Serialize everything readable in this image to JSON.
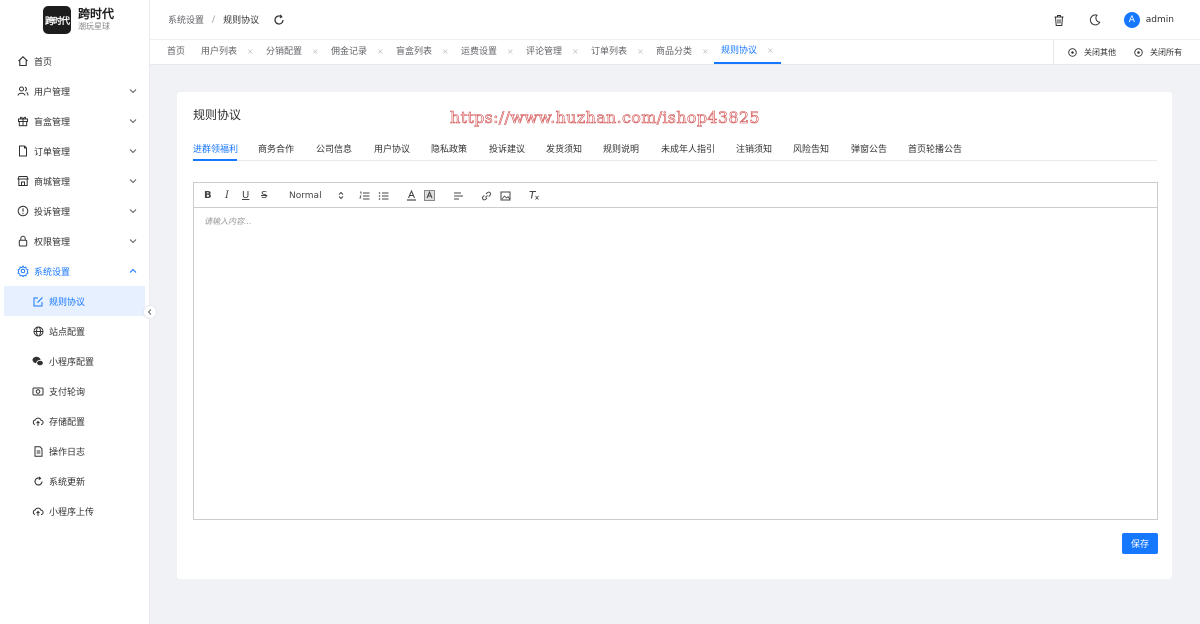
{
  "brand": {
    "mark": "跨时代",
    "title": "跨时代",
    "subtitle": "潮玩星球"
  },
  "sidebar": {
    "items": [
      {
        "label": "首页",
        "icon": "home-icon",
        "expandable": false
      },
      {
        "label": "用户管理",
        "icon": "users-icon",
        "expandable": true
      },
      {
        "label": "盲盒管理",
        "icon": "gift-icon",
        "expandable": true
      },
      {
        "label": "订单管理",
        "icon": "document-icon",
        "expandable": true
      },
      {
        "label": "商城管理",
        "icon": "store-icon",
        "expandable": true
      },
      {
        "label": "投诉管理",
        "icon": "alert-icon",
        "expandable": true
      },
      {
        "label": "权限管理",
        "icon": "lock-icon",
        "expandable": true
      },
      {
        "label": "系统设置",
        "icon": "settings-icon",
        "expandable": true,
        "expanded": true
      }
    ],
    "sub_items": [
      {
        "label": "规则协议",
        "icon": "edit-icon",
        "active": true
      },
      {
        "label": "站点配置",
        "icon": "globe-icon"
      },
      {
        "label": "小程序配置",
        "icon": "wechat-icon"
      },
      {
        "label": "支付轮询",
        "icon": "payment-icon"
      },
      {
        "label": "存储配置",
        "icon": "cloud-icon"
      },
      {
        "label": "操作日志",
        "icon": "file-icon"
      },
      {
        "label": "系统更新",
        "icon": "refresh-icon"
      },
      {
        "label": "小程序上传",
        "icon": "upload-icon"
      }
    ]
  },
  "header": {
    "breadcrumb": [
      "系统设置",
      "规则协议"
    ],
    "separator": "/",
    "avatar_letter": "A",
    "username": "admin"
  },
  "tabs": {
    "items": [
      "首页",
      "用户列表",
      "分销配置",
      "佣金记录",
      "盲盒列表",
      "运费设置",
      "评论管理",
      "订单列表",
      "商品分类",
      "规则协议"
    ],
    "active": "规则协议",
    "close_glyph": "×",
    "close_others": "关闭其他",
    "close_all": "关闭所有"
  },
  "card": {
    "title": "规则协议",
    "watermark": "https://www.huzhan.com/ishop43825",
    "subtabs": [
      "进群领福利",
      "商务合作",
      "公司信息",
      "用户协议",
      "隐私政策",
      "投诉建议",
      "发货须知",
      "规则说明",
      "未成年人指引",
      "注销须知",
      "风险告知",
      "弹窗公告",
      "首页轮播公告"
    ],
    "active_subtab": "进群领福利"
  },
  "editor": {
    "toolbar": {
      "bold": "B",
      "italic": "I",
      "underline": "U",
      "strike": "S",
      "heading_select": "Normal"
    },
    "placeholder": "请输入内容..."
  },
  "actions": {
    "save_label": "保存"
  },
  "colors": {
    "accent": "#1677ff",
    "active_bg": "#e6f0ff",
    "page_bg": "#f0f2f5"
  }
}
